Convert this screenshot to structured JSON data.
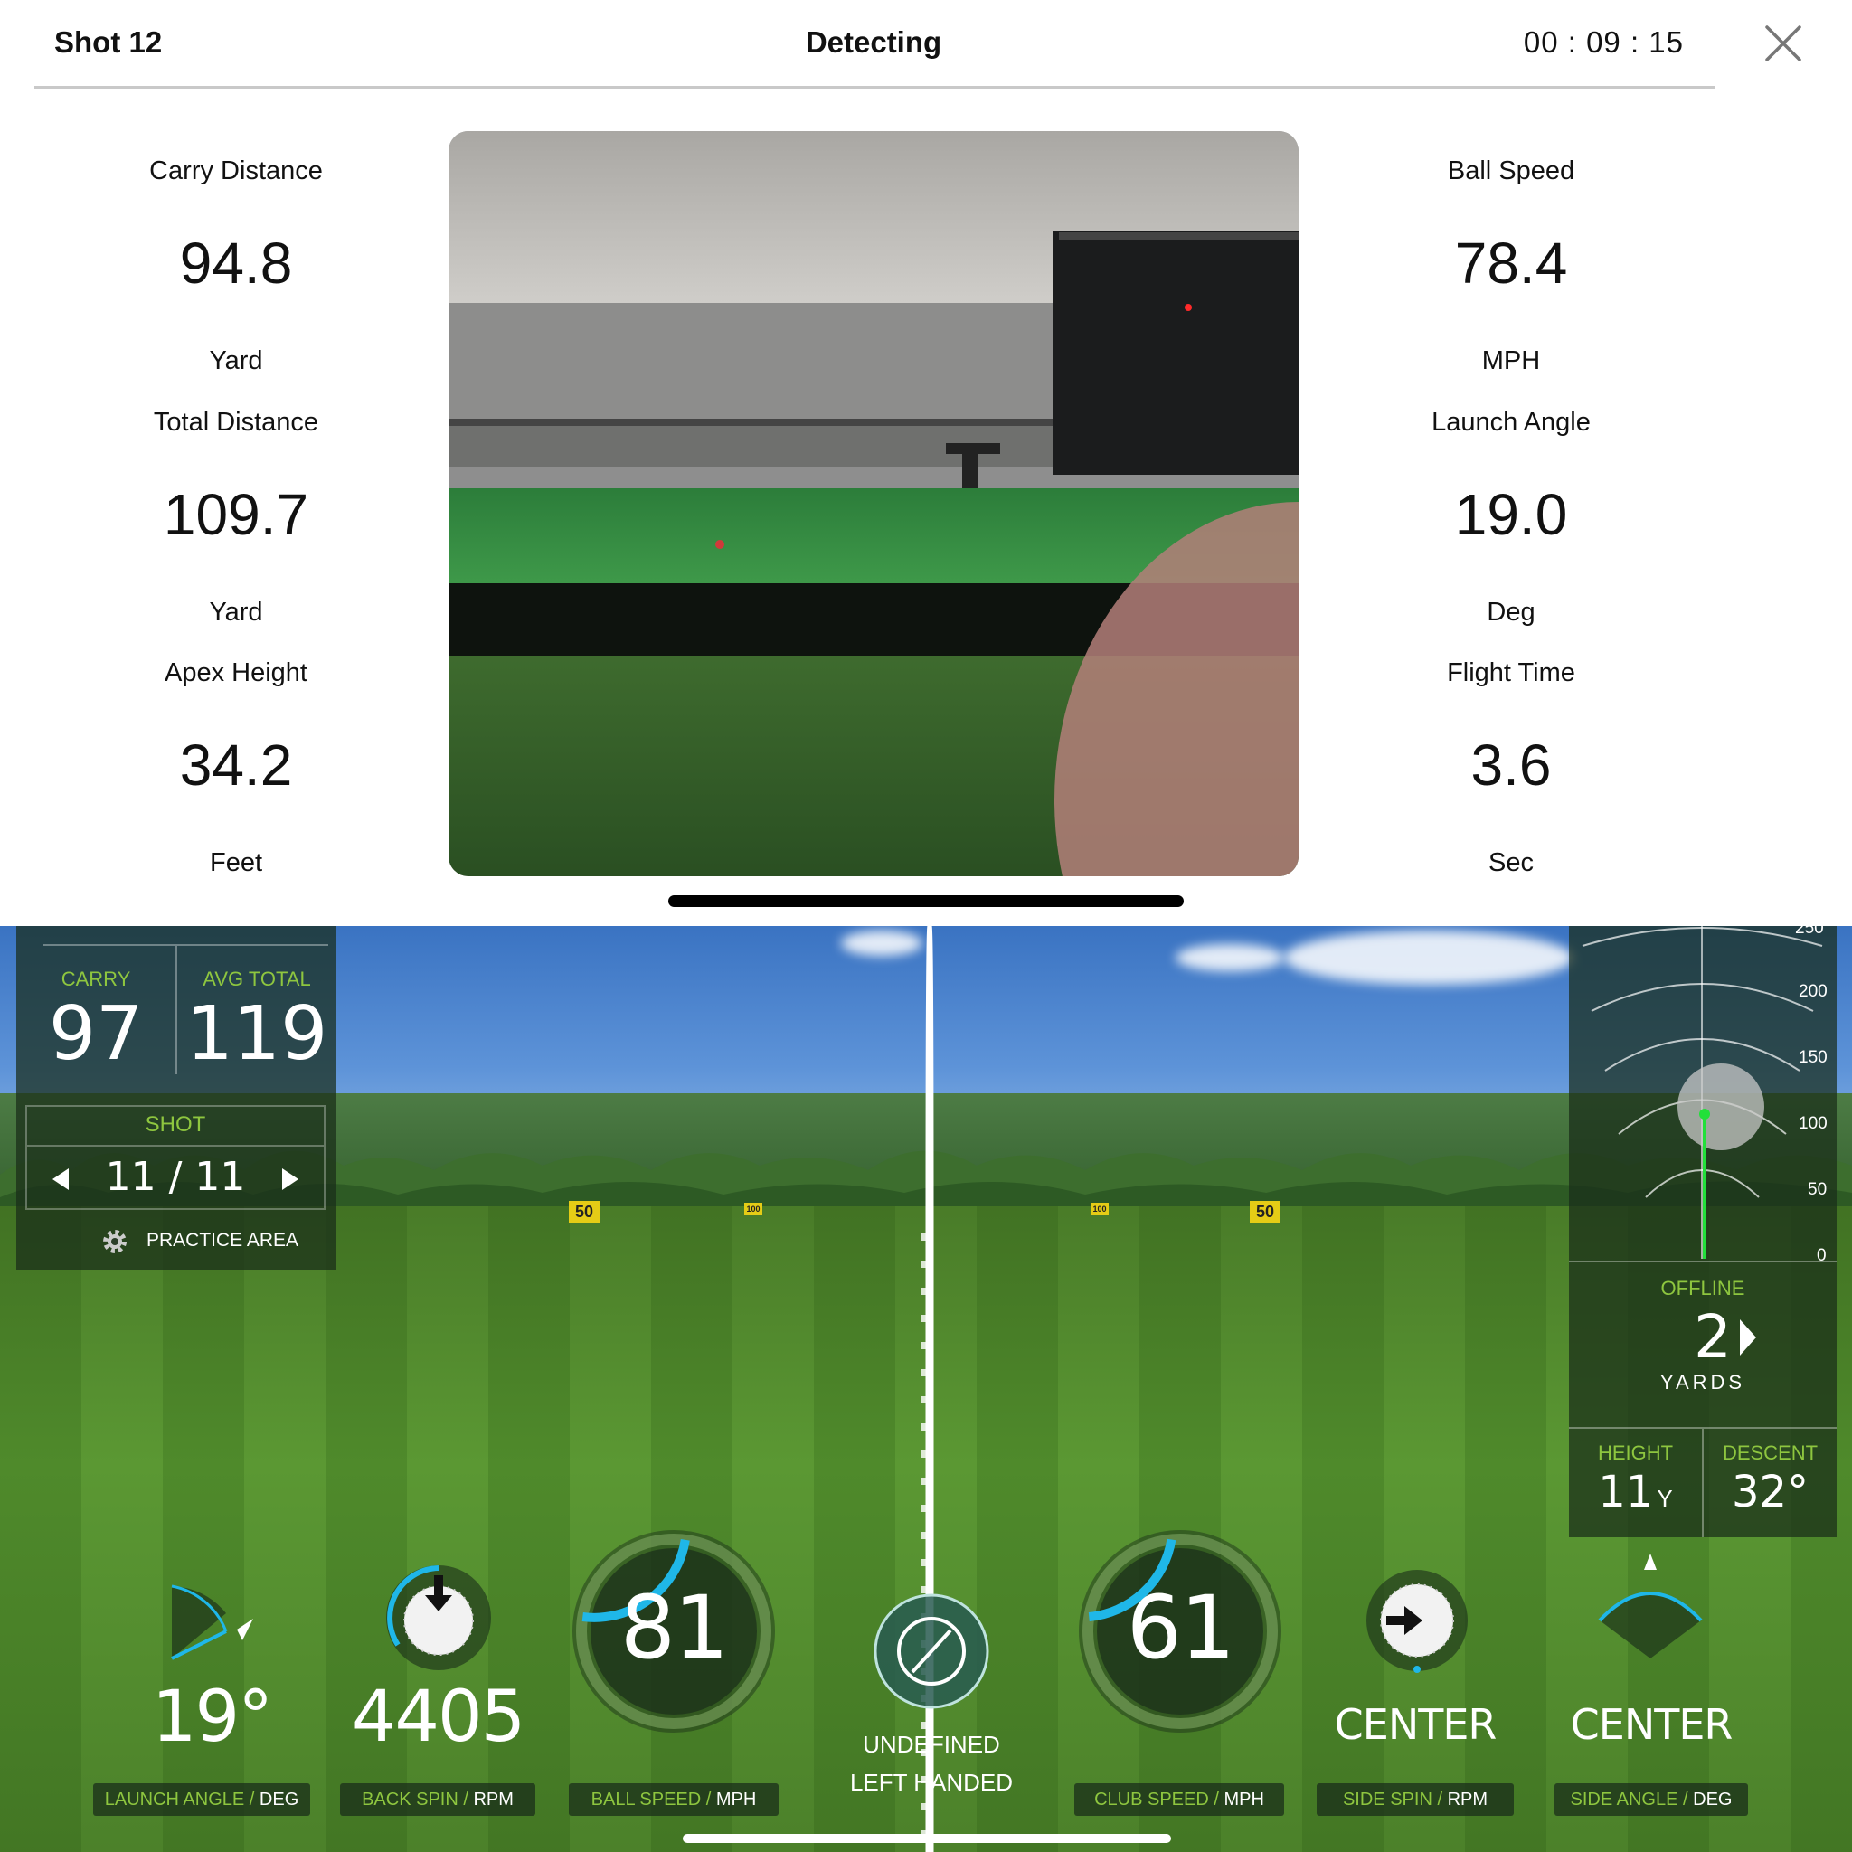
{
  "header": {
    "shot_label": "Shot 12",
    "status": "Detecting",
    "timer": "00 : 09 : 15"
  },
  "left_stats": [
    {
      "label": "Carry Distance",
      "value": "94.8",
      "unit": "Yard"
    },
    {
      "label": "Total Distance",
      "value": "109.7",
      "unit": "Yard"
    },
    {
      "label": "Apex Height",
      "value": "34.2",
      "unit": "Feet"
    }
  ],
  "right_stats": [
    {
      "label": "Ball Speed",
      "value": "78.4",
      "unit": "MPH"
    },
    {
      "label": "Launch Angle",
      "value": "19.0",
      "unit": "Deg"
    },
    {
      "label": "Flight Time",
      "value": "3.6",
      "unit": "Sec"
    }
  ],
  "sim": {
    "carry_label": "CARRY",
    "carry_value": "97",
    "avg_total_label": "AVG TOTAL",
    "avg_total_value": "119",
    "shot_label": "SHOT",
    "shot_counter": "11 / 11",
    "practice_area": "PRACTICE AREA",
    "yard_signs": [
      "50",
      "100",
      "100",
      "50"
    ],
    "radar_ticks": [
      "250",
      "200",
      "150",
      "100",
      "50",
      "0"
    ],
    "offline_label": "OFFLINE",
    "offline_value": "2",
    "offline_unit": "YARDS",
    "height_label": "HEIGHT",
    "height_value": "11",
    "height_unit": "Y",
    "descent_label": "DESCENT",
    "descent_value": "32°",
    "metrics": {
      "launch_angle": {
        "value": "19°",
        "label": "LAUNCH ANGLE",
        "unit": "DEG"
      },
      "back_spin": {
        "value": "4405",
        "label": "BACK SPIN",
        "unit": "RPM"
      },
      "ball_speed": {
        "value": "81",
        "label": "BALL SPEED",
        "unit": "MPH",
        "fill": 0.35
      },
      "club": {
        "line1": "UNDEFINED",
        "line2": "LEFT HANDED"
      },
      "club_speed": {
        "value": "61",
        "label": "CLUB SPEED",
        "unit": "MPH",
        "fill": 0.3
      },
      "side_spin": {
        "value": "CENTER",
        "label": "SIDE SPIN",
        "unit": "RPM"
      },
      "side_angle": {
        "value": "CENTER",
        "label": "SIDE ANGLE",
        "unit": "DEG"
      }
    }
  },
  "colors": {
    "accent_green": "#8ec63f",
    "gauge_blue": "#1fb7e8",
    "yard_sign": "#e5cc16"
  }
}
